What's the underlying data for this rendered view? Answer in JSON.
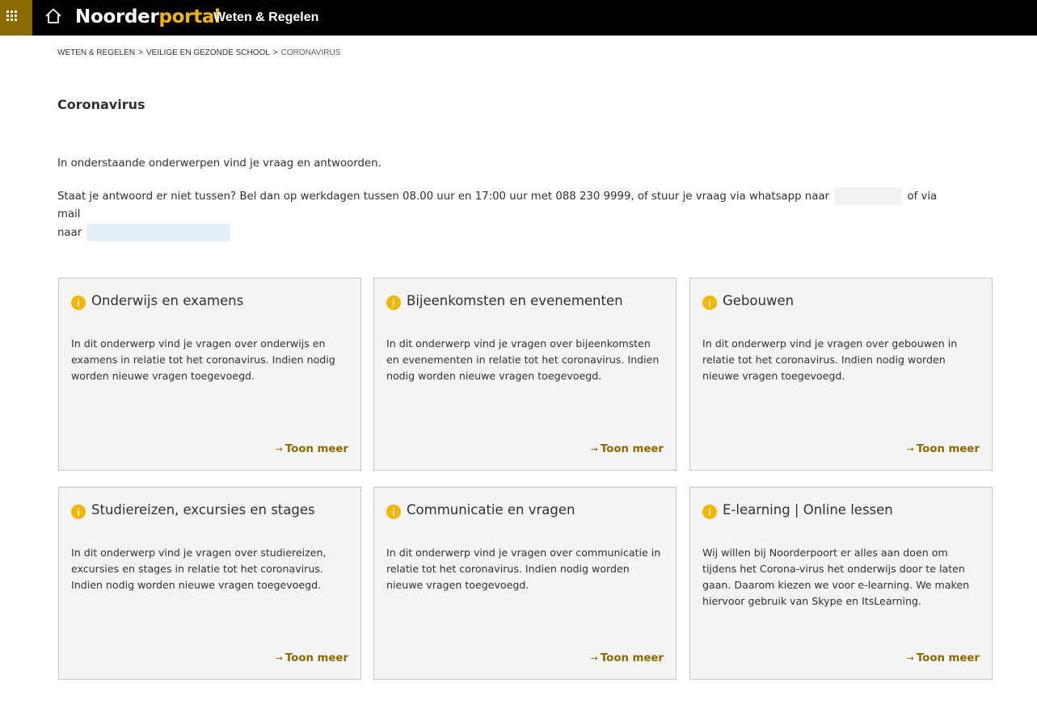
{
  "header": {
    "logo_part1": "Noorder",
    "logo_part2": "portal",
    "site_title": "Weten & Regelen"
  },
  "breadcrumb": [
    {
      "label": "WETEN & REGELEN"
    },
    {
      "label": "VEILIGE EN GEZONDE SCHOOL"
    },
    {
      "label": "CORONAVIRUS"
    }
  ],
  "breadcrumb_separator": ">",
  "page_title": "Coronavirus",
  "intro": "In onderstaande onderwerpen vind je vraag en antwoorden.",
  "contact": {
    "text_before_phone": "Staat je antwoord er niet tussen? Bel dan op werkdagen tussen 08.00 uur en 17:00 uur met 088 230 9999, of stuur je vraag via whatsapp naar",
    "text_between": "of via mail",
    "text_before_mail": "naar"
  },
  "cards": [
    {
      "title": "Onderwijs en examens",
      "description": "In dit onderwerp vind je vragen over onderwijs en examens in relatie tot het coronavirus. Indien nodig worden nieuwe vragen toegevoegd.",
      "link": "Toon meer"
    },
    {
      "title": "Bijeenkomsten en evenementen",
      "description": "In dit onderwerp vind je vragen over bijeenkomsten en evenementen in relatie tot het coronavirus. Indien nodig worden nieuwe vragen toegevoegd.",
      "link": "Toon meer"
    },
    {
      "title": "Gebouwen",
      "description": "In dit onderwerp vind je vragen over gebouwen in relatie tot het coronavirus. Indien nodig worden nieuwe vragen toegevoegd.",
      "link": "Toon meer"
    },
    {
      "title": "Studiereizen, excursies en stages",
      "description": "In dit onderwerp vind je vragen over studiereizen, excursies en stages in relatie tot het coronavirus. Indien nodig worden nieuwe vragen toegevoegd.",
      "link": "Toon meer"
    },
    {
      "title": "Communicatie en vragen",
      "description": "In dit onderwerp vind je vragen over communicatie in relatie tot het coronavirus. Indien nodig worden nieuwe vragen toegevoegd.",
      "link": "Toon meer"
    },
    {
      "title": "E-learning | Online lessen",
      "description": "Wij willen bij Noorderpoort er alles aan doen om tijdens het Corona-virus het onderwijs door te laten gaan. Daarom kiezen we voor e-learning. We maken hiervoor gebruik van Skype en ItsLearning.",
      "link": "Toon meer"
    }
  ],
  "icons": {
    "app_launcher": "waffle-icon",
    "home": "home-icon",
    "card_info": "info-icon",
    "link_arrow": "arrow-right-icon"
  },
  "colors": {
    "topbar": "#000000",
    "accent": "#8a6a00",
    "logo_highlight": "#f2b705",
    "card_bg": "#f4f4f4",
    "card_border": "#c8c6c4"
  }
}
